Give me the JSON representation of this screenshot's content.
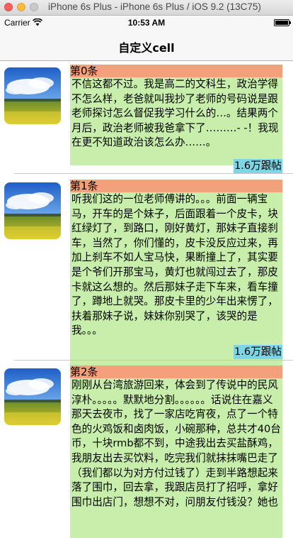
{
  "window": {
    "title": "iPhone 6s Plus - iPhone 6s Plus / iOS 9.2 (13C75)"
  },
  "status_bar": {
    "carrier": "Carrier",
    "time": "10:53 AM",
    "battery_level": 1.0
  },
  "nav": {
    "title": "自定义cell"
  },
  "cells": [
    {
      "name": "第0条",
      "text": "不信这都不过。我是高二的文科生，政治学得不怎么样，老爸就叫我抄了老师的号码说是跟老师探讨怎么督促我学习什么的…。结果两个月后，政治老师被我爸拿下了………- -！我现在更不知道政治该怎么办……。",
      "replies": "1.6万跟帖"
    },
    {
      "name": "第1条",
      "text": "听我们这的一位老师傅讲的。。。前面一辆宝马，开车的是个妹子，后面跟着一个皮卡，块红绿灯了，到路口，刚好黄灯，那妹子直接刹车，当然了，你们懂的，皮卡没反应过来，再加上刹车不如人宝马快，果断撞上了，其实要是个爷们开那宝马，黄灯也就闯过去了，那皮卡就这么想的。然后那妹子走下车来，看车撞了，蹲地上就哭。那皮卡里的少年出来愣了，扶着那妹子说，妹妹你别哭了，该哭的是我。。。",
      "replies": "1.6万跟帖"
    },
    {
      "name": "第2条",
      "text": "刚刚从台湾旅游回来，体会到了传说中的民风淳朴。。。。。默默地分割。。。。。。话说住在嘉义那天去夜市，找了一家店吃宵夜，点了一个特色的火鸡饭和卤肉饭，小碗那种，总共才40台币，十块rmb都不到，中途我出去买盐酥鸡，我朋友出去买饮料，吃完我们就抹抹嘴巴走了（我们都以为对方付过钱了）走到半路想起来落了围巾，回去拿，我跟店员打了招呼，拿好围巾出店门，想想不对，问朋友付钱没？她也",
      "replies": ""
    }
  ]
}
